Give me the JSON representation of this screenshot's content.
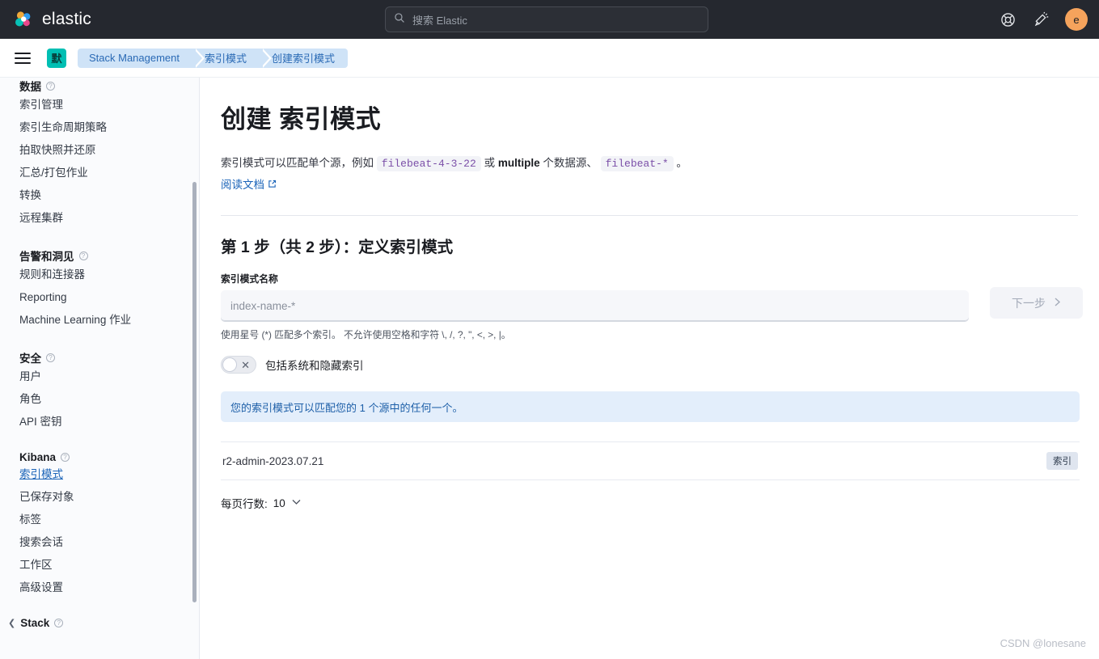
{
  "topbar": {
    "brand": "elastic",
    "brand_logo_icon": "elastic-logo-icon",
    "search": {
      "icon": "search-icon",
      "placeholder": "搜索 Elastic",
      "value": ""
    },
    "help_icon": "lifebuoy-help-icon",
    "news_icon": "announcement-megaphone-icon",
    "avatar_initial": "e",
    "avatar_color": "#f5a35c"
  },
  "breadcrumbbar": {
    "menu_icon": "hamburger-menu-icon",
    "space_badge": "默",
    "space_badge_color": "#00bfb3",
    "crumbs": [
      {
        "label": "Stack Management"
      },
      {
        "label": "索引模式"
      },
      {
        "label": "创建索引模式"
      }
    ]
  },
  "sidebar": {
    "groups": [
      {
        "title": "数据",
        "help_icon": "question-circle-icon",
        "items": [
          {
            "label": "索引管理",
            "active": false
          },
          {
            "label": "索引生命周期策略",
            "active": false
          },
          {
            "label": "拍取快照并还原",
            "active": false
          },
          {
            "label": "汇总/打包作业",
            "active": false
          },
          {
            "label": "转换",
            "active": false
          },
          {
            "label": "远程集群",
            "active": false
          }
        ]
      },
      {
        "title": "告警和洞见",
        "help_icon": "question-circle-icon",
        "items": [
          {
            "label": "规则和连接器",
            "active": false
          },
          {
            "label": "Reporting",
            "active": false
          },
          {
            "label": "Machine Learning 作业",
            "active": false
          }
        ]
      },
      {
        "title": "安全",
        "help_icon": "question-circle-icon",
        "items": [
          {
            "label": "用户",
            "active": false
          },
          {
            "label": "角色",
            "active": false
          },
          {
            "label": "API 密钥",
            "active": false
          }
        ]
      },
      {
        "title": "Kibana",
        "help_icon": "question-circle-icon",
        "items": [
          {
            "label": "索引模式",
            "active": true
          },
          {
            "label": "已保存对象",
            "active": false
          },
          {
            "label": "标签",
            "active": false
          },
          {
            "label": "搜索会话",
            "active": false
          },
          {
            "label": "工作区",
            "active": false
          },
          {
            "label": "高级设置",
            "active": false
          }
        ]
      }
    ],
    "footer_group": {
      "title": "Stack",
      "collapse_icon": "chevron-left-icon",
      "help_icon": "question-circle-icon"
    }
  },
  "main": {
    "page_title": "创建 索引模式",
    "description": {
      "prefix": "索引模式可以匹配单个源，例如",
      "code1": "filebeat-4-3-22",
      "middle1": "或",
      "bold": "multiple",
      "middle2": "个数据源、",
      "code2": "filebeat-*",
      "suffix": "。"
    },
    "doc_link": {
      "label": "阅读文档",
      "icon": "external-link-icon"
    },
    "step_title": "第 1 步（共 2 步）：定义索引模式",
    "field": {
      "label": "索引模式名称",
      "placeholder": "index-name-*",
      "value": "",
      "help": "使用星号 (*) 匹配多个索引。 不允许使用空格和字符 \\, /, ?, \", <, >, |。"
    },
    "next_button": {
      "label": "下一步",
      "icon": "chevron-right-icon",
      "disabled": true
    },
    "toggle": {
      "label": "包括系统和隐藏索引",
      "state": "off",
      "off_icon": "cross-icon"
    },
    "callout": {
      "text": "您的索引模式可以匹配您的 1 个源中的任何一个。",
      "color": "#e3eefb"
    },
    "table": {
      "rows": [
        {
          "name": "r2-admin-2023.07.21",
          "tag": "索引"
        }
      ]
    },
    "pagination": {
      "label": "每页行数:",
      "value": "10",
      "icon": "chevron-down-icon"
    }
  },
  "watermark": "CSDN @lonesane"
}
